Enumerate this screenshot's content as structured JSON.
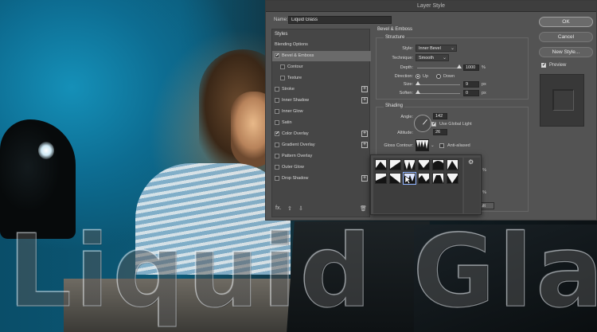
{
  "dialog": {
    "title": "Layer Style",
    "name_label": "Name:",
    "name_value": "Liquid Glass"
  },
  "styles_panel": {
    "header": "Styles",
    "items": [
      {
        "label": "Blending Options",
        "checkbox": false,
        "checked": false,
        "plus": false,
        "indent": false,
        "active": false
      },
      {
        "label": "Bevel & Emboss",
        "checkbox": true,
        "checked": true,
        "plus": false,
        "indent": false,
        "active": true
      },
      {
        "label": "Contour",
        "checkbox": true,
        "checked": false,
        "plus": false,
        "indent": true,
        "active": false
      },
      {
        "label": "Texture",
        "checkbox": true,
        "checked": false,
        "plus": false,
        "indent": true,
        "active": false
      },
      {
        "label": "Stroke",
        "checkbox": true,
        "checked": false,
        "plus": true,
        "indent": false,
        "active": false
      },
      {
        "label": "Inner Shadow",
        "checkbox": true,
        "checked": false,
        "plus": true,
        "indent": false,
        "active": false
      },
      {
        "label": "Inner Glow",
        "checkbox": true,
        "checked": false,
        "plus": false,
        "indent": false,
        "active": false
      },
      {
        "label": "Satin",
        "checkbox": true,
        "checked": false,
        "plus": false,
        "indent": false,
        "active": false
      },
      {
        "label": "Color Overlay",
        "checkbox": true,
        "checked": true,
        "plus": true,
        "indent": false,
        "active": false
      },
      {
        "label": "Gradient Overlay",
        "checkbox": true,
        "checked": false,
        "plus": true,
        "indent": false,
        "active": false
      },
      {
        "label": "Pattern Overlay",
        "checkbox": true,
        "checked": false,
        "plus": false,
        "indent": false,
        "active": false
      },
      {
        "label": "Outer Glow",
        "checkbox": true,
        "checked": false,
        "plus": false,
        "indent": false,
        "active": false
      },
      {
        "label": "Drop Shadow",
        "checkbox": true,
        "checked": false,
        "plus": true,
        "indent": false,
        "active": false
      }
    ],
    "footer": {
      "fx": "fx.",
      "up": "⇧",
      "down": "⇩",
      "trash": "🗑"
    }
  },
  "buttons": {
    "ok": "OK",
    "cancel": "Cancel",
    "new_style": "New Style...",
    "preview_label": "Preview",
    "preview_checked": true
  },
  "bevel": {
    "section": "Bevel & Emboss",
    "structure": "Structure",
    "style_label": "Style:",
    "style_value": "Inner Bevel",
    "technique_label": "Technique:",
    "technique_value": "Smooth",
    "depth_label": "Depth:",
    "depth_value": "1000",
    "depth_unit": "%",
    "direction_label": "Direction:",
    "direction_up": "Up",
    "direction_down": "Down",
    "direction_selected": "Up",
    "size_label": "Size:",
    "size_value": "9",
    "size_unit": "px",
    "soften_label": "Soften:",
    "soften_value": "0",
    "soften_unit": "px"
  },
  "shading": {
    "title": "Shading",
    "angle_label": "Angle:",
    "angle_value": "142",
    "global_light_label": "Use Global Light",
    "global_light_checked": true,
    "altitude_label": "Altitude:",
    "altitude_value": "26",
    "gloss_label": "Gloss Contour:",
    "anti_aliased_label": "Anti-aliased",
    "anti_aliased_checked": false,
    "partial_right_1": "%",
    "partial_right_2": "%",
    "partial_right_3": "ault"
  },
  "canvas_text": "Liquid Glass"
}
